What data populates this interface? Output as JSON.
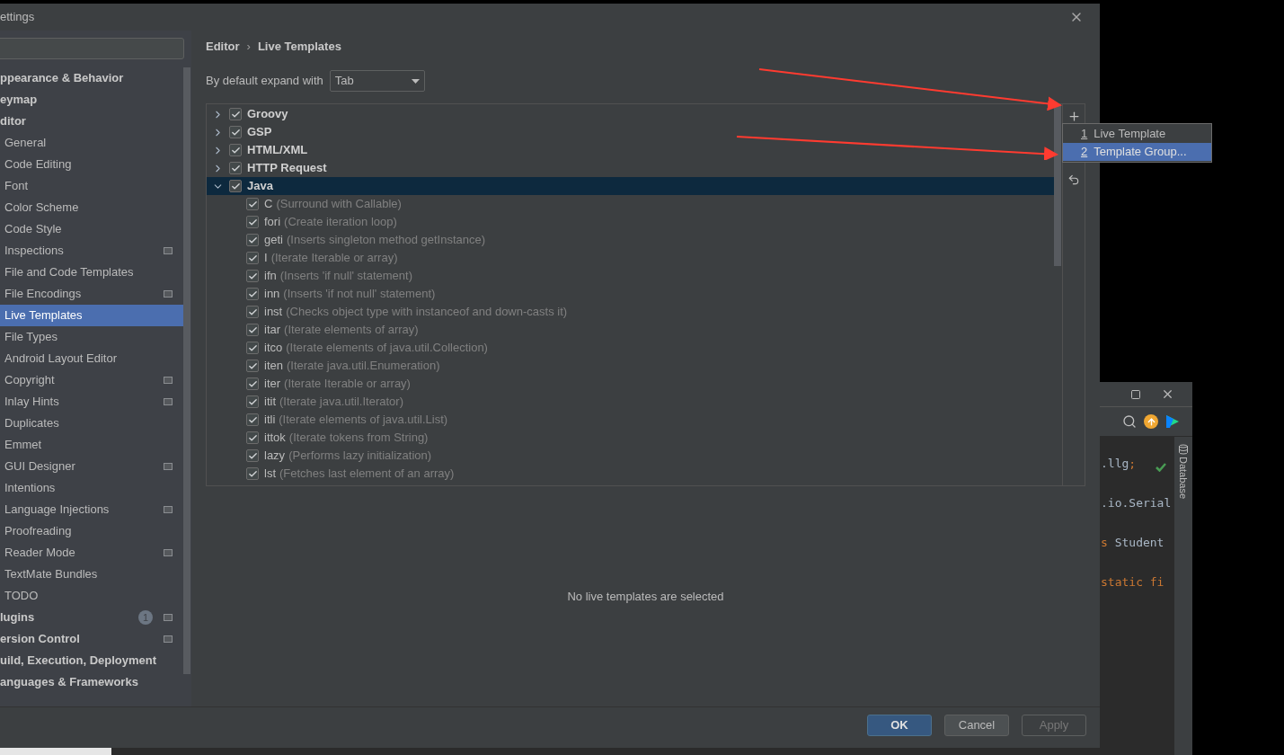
{
  "dialog": {
    "title": "ettings",
    "sidebar": {
      "items": [
        {
          "kind": "group",
          "label": "ppearance & Behavior",
          "selected": false
        },
        {
          "kind": "group",
          "label": "eymap",
          "selected": false
        },
        {
          "kind": "group",
          "label": "ditor",
          "selected": false
        },
        {
          "kind": "item",
          "label": "General",
          "selected": false,
          "project_level": false
        },
        {
          "kind": "item",
          "label": "Code Editing",
          "selected": false,
          "project_level": false
        },
        {
          "kind": "item",
          "label": "Font",
          "selected": false,
          "project_level": false
        },
        {
          "kind": "item",
          "label": "Color Scheme",
          "selected": false,
          "project_level": false
        },
        {
          "kind": "item",
          "label": "Code Style",
          "selected": false,
          "project_level": false
        },
        {
          "kind": "item",
          "label": "Inspections",
          "selected": false,
          "project_level": true
        },
        {
          "kind": "item",
          "label": "File and Code Templates",
          "selected": false,
          "project_level": false
        },
        {
          "kind": "item",
          "label": "File Encodings",
          "selected": false,
          "project_level": true
        },
        {
          "kind": "item",
          "label": "Live Templates",
          "selected": true,
          "project_level": false
        },
        {
          "kind": "item",
          "label": "File Types",
          "selected": false,
          "project_level": false
        },
        {
          "kind": "item",
          "label": "Android Layout Editor",
          "selected": false,
          "project_level": false
        },
        {
          "kind": "item",
          "label": "Copyright",
          "selected": false,
          "project_level": true
        },
        {
          "kind": "item",
          "label": "Inlay Hints",
          "selected": false,
          "project_level": true
        },
        {
          "kind": "item",
          "label": "Duplicates",
          "selected": false,
          "project_level": false
        },
        {
          "kind": "item",
          "label": "Emmet",
          "selected": false,
          "project_level": false
        },
        {
          "kind": "item",
          "label": "GUI Designer",
          "selected": false,
          "project_level": true
        },
        {
          "kind": "item",
          "label": "Intentions",
          "selected": false,
          "project_level": false
        },
        {
          "kind": "item",
          "label": "Language Injections",
          "selected": false,
          "project_level": true
        },
        {
          "kind": "item",
          "label": "Proofreading",
          "selected": false,
          "project_level": false
        },
        {
          "kind": "item",
          "label": "Reader Mode",
          "selected": false,
          "project_level": true
        },
        {
          "kind": "item",
          "label": "TextMate Bundles",
          "selected": false,
          "project_level": false
        },
        {
          "kind": "item",
          "label": "TODO",
          "selected": false,
          "project_level": false
        },
        {
          "kind": "group",
          "label": "lugins",
          "selected": false,
          "badge": "1",
          "project_level": true
        },
        {
          "kind": "group",
          "label": "ersion Control",
          "selected": false,
          "project_level": true
        },
        {
          "kind": "group",
          "label": "uild, Execution, Deployment",
          "selected": false
        },
        {
          "kind": "group",
          "label": "anguages & Frameworks",
          "selected": false
        }
      ]
    },
    "breadcrumb": [
      "Editor",
      "›",
      "Live Templates"
    ],
    "expand_with": {
      "label": "By default expand with",
      "value": "Tab"
    },
    "groups": [
      {
        "name": "Groovy",
        "checked": true,
        "expanded": false,
        "selected": false
      },
      {
        "name": "GSP",
        "checked": true,
        "expanded": false,
        "selected": false
      },
      {
        "name": "HTML/XML",
        "checked": true,
        "expanded": false,
        "selected": false
      },
      {
        "name": "HTTP Request",
        "checked": true,
        "expanded": false,
        "selected": false
      },
      {
        "name": "Java",
        "checked": true,
        "expanded": true,
        "selected": true,
        "children": [
          {
            "abbr": "C",
            "description": "(Surround with Callable)",
            "checked": true
          },
          {
            "abbr": "fori",
            "description": "(Create iteration loop)",
            "checked": true
          },
          {
            "abbr": "geti",
            "description": "(Inserts singleton method getInstance)",
            "checked": true
          },
          {
            "abbr": "I",
            "description": "(Iterate Iterable or array)",
            "checked": true
          },
          {
            "abbr": "ifn",
            "description": "(Inserts 'if null' statement)",
            "checked": true
          },
          {
            "abbr": "inn",
            "description": "(Inserts 'if not null' statement)",
            "checked": true
          },
          {
            "abbr": "inst",
            "description": "(Checks object type with instanceof and down-casts it)",
            "checked": true
          },
          {
            "abbr": "itar",
            "description": "(Iterate elements of array)",
            "checked": true
          },
          {
            "abbr": "itco",
            "description": "(Iterate elements of java.util.Collection)",
            "checked": true
          },
          {
            "abbr": "iten",
            "description": "(Iterate java.util.Enumeration)",
            "checked": true
          },
          {
            "abbr": "iter",
            "description": "(Iterate Iterable or array)",
            "checked": true
          },
          {
            "abbr": "itit",
            "description": "(Iterate java.util.Iterator)",
            "checked": true
          },
          {
            "abbr": "itli",
            "description": "(Iterate elements of java.util.List)",
            "checked": true
          },
          {
            "abbr": "ittok",
            "description": "(Iterate tokens from String)",
            "checked": true
          },
          {
            "abbr": "lazy",
            "description": "(Performs lazy initialization)",
            "checked": true
          },
          {
            "abbr": "lst",
            "description": "(Fetches last element of an array)",
            "checked": true
          }
        ]
      }
    ],
    "add_menu": [
      {
        "mnemonic": "1",
        "label": "Live Template",
        "selected": false
      },
      {
        "mnemonic": "2",
        "label": "Template Group...",
        "selected": true
      }
    ],
    "empty_message": "No live templates are selected",
    "buttons": [
      {
        "label": "OK",
        "kind": "primary"
      },
      {
        "label": "Cancel",
        "kind": "normal"
      },
      {
        "label": "Apply",
        "kind": "disabled"
      }
    ]
  },
  "editor_window": {
    "code_lines": [
      [
        {
          "text": ".llg",
          "kind": "plain"
        },
        {
          "text": ";",
          "kind": "keyword"
        }
      ],
      [
        {
          "text": ".io.Serial",
          "kind": "plain"
        }
      ],
      [
        {
          "text": "s",
          "kind": "keyword"
        },
        {
          "text": " Student",
          "kind": "plain"
        }
      ],
      [
        {
          "text": "static fi",
          "kind": "keyword"
        }
      ]
    ],
    "side_tab": "Database"
  }
}
